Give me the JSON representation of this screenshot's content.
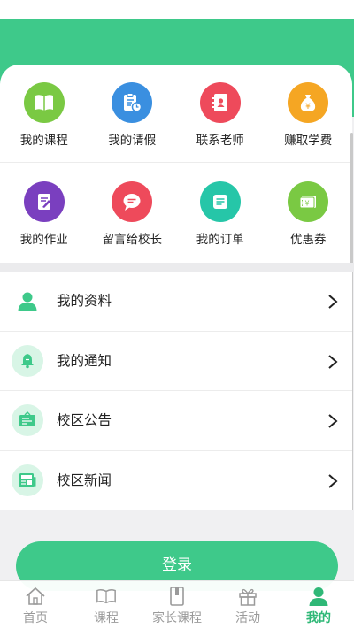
{
  "colors": {
    "brand": "#3ec98a",
    "purple": "#7a3fbf",
    "red": "#ee4a5b",
    "teal": "#26c6a8",
    "lime": "#7ac943",
    "blue": "#3a8fe0",
    "amber": "#f5a623",
    "tab_inactive": "#9a9a9a",
    "tab_active": "#2fb877"
  },
  "grid": {
    "row1": [
      {
        "label": "我的课程",
        "icon": "book-icon"
      },
      {
        "label": "我的请假",
        "icon": "clipboard-clock-icon"
      },
      {
        "label": "联系老师",
        "icon": "contacts-icon"
      },
      {
        "label": "赚取学费",
        "icon": "money-bag-icon"
      }
    ],
    "row2": [
      {
        "label": "我的作业",
        "icon": "homework-icon"
      },
      {
        "label": "留言给校长",
        "icon": "message-icon"
      },
      {
        "label": "我的订单",
        "icon": "order-icon"
      },
      {
        "label": "优惠券",
        "icon": "coupon-icon"
      }
    ]
  },
  "list": [
    {
      "label": "我的资料",
      "icon": "user-icon"
    },
    {
      "label": "我的通知",
      "icon": "bell-icon"
    },
    {
      "label": "校区公告",
      "icon": "notice-board-icon"
    },
    {
      "label": "校区新闻",
      "icon": "newspaper-icon"
    }
  ],
  "login": {
    "label": "登录"
  },
  "tabs": [
    {
      "label": "首页",
      "icon": "home-icon"
    },
    {
      "label": "课程",
      "icon": "open-book-icon"
    },
    {
      "label": "家长课程",
      "icon": "notebook-icon"
    },
    {
      "label": "活动",
      "icon": "gift-icon"
    },
    {
      "label": "我的",
      "icon": "profile-icon",
      "active": true
    }
  ]
}
